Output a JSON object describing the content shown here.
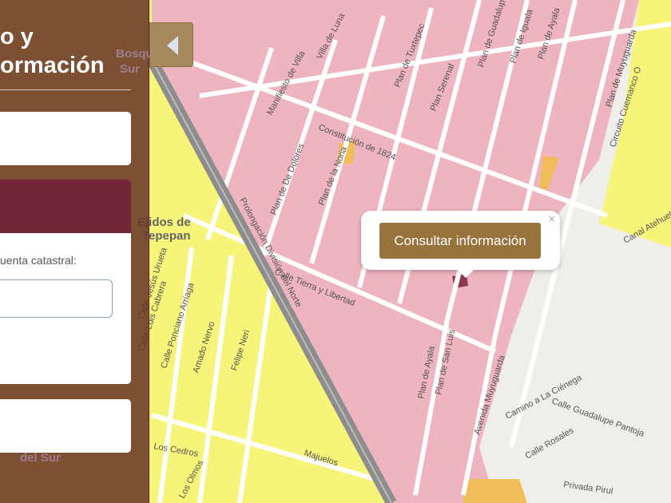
{
  "sidebar": {
    "title_line1": "o y",
    "title_line2": "ormación",
    "field_label": "uenta catastral:",
    "input_value": ""
  },
  "popup": {
    "button_label": "Consultar información",
    "close": "×"
  },
  "map": {
    "labels": {
      "bosques": "Bosques",
      "sur": "Sur",
      "ejidos": "Ejidos de",
      "tepepan": "Tepepan",
      "del_sur": "del Sur",
      "manifesto": "Manifiesto de Villa",
      "villa_luna": "Villa de Luna",
      "plan_dolores": "Plan de De Dolores",
      "plan_noria": "Plan de la Noria",
      "constitucion": "Constitución de 1824",
      "plan_tuxtepec": "Plan de Tuxtepec",
      "plan_serenal": "Plan Serenal",
      "plan_guadalupe": "Plan de Guadalupe",
      "plan_iguala": "Plan de Iguala",
      "plan_ayala_top": "Plan de Ayala",
      "plan_muyuguarda": "Plan de Muyuguarda",
      "circuito": "Circuito Cuemanco O",
      "prolongacion": "Prolongación División del Norte",
      "tierra": "Calle Tierra y Libertad",
      "canal": "Canal Atehuelco",
      "plan_ayala": "Plan de Ayala",
      "plan_san_luis": "Plan de San Luis",
      "avenida": "Avenida Muyuguarda",
      "camino": "Camino a La Ciénega",
      "guadalupe_pantoja": "Calle Guadalupe Pantoja",
      "rosales": "Calle Rosales",
      "pirul": "Privada Pirul",
      "majuelos": "Majuelos",
      "cedros": "Los Cedros",
      "olmos": "Los Olmos",
      "urueta": "Calle Jesús Urueta",
      "cabrera": "Calle Luis Cabrera",
      "arriaga": "Calle Ponciano Arriaga",
      "nervo": "Amado Nervo",
      "neri": "Felipe Neri"
    }
  },
  "colors": {
    "pink": "#eeb4c0",
    "yellow": "#f7f47a",
    "orange": "#f0bd5a",
    "selected": "#8c3a4a"
  }
}
